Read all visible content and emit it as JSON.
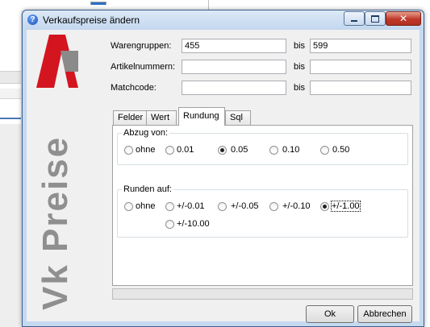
{
  "window": {
    "title": "Verkaufspreise ändern"
  },
  "icons": {
    "help": "question-circle-icon",
    "logo": "red-a-logo",
    "close_glyph": "✕"
  },
  "brand": {
    "vertical_text": "Vk Preise",
    "logo_red": "#d3151f",
    "logo_gray": "#8a8a8a"
  },
  "form": {
    "warengruppen": {
      "label": "Warengruppen:",
      "from": "455",
      "to_label": "bis",
      "to": "599"
    },
    "artikelnummern": {
      "label": "Artikelnummern:",
      "from": "",
      "to_label": "bis",
      "to": ""
    },
    "matchcode": {
      "label": "Matchcode:",
      "from": "",
      "to_label": "bis",
      "to": ""
    }
  },
  "tabs": [
    "Felder",
    "Wert",
    "Rundung",
    "Sql"
  ],
  "active_tab": "Rundung",
  "abzug": {
    "title": "Abzug von:",
    "options": [
      "ohne",
      "0.01",
      "0.05",
      "0.10",
      "0.50"
    ],
    "selected": "0.05"
  },
  "runden": {
    "title": "Runden auf:",
    "options": [
      "ohne",
      "+/-0.01",
      "+/-0.05",
      "+/-0.10",
      "+/-1.00",
      "+/-10.00"
    ],
    "selected": "+/-1.00"
  },
  "progress": 0,
  "buttons": {
    "ok": "Ok",
    "cancel": "Abbrechen"
  }
}
